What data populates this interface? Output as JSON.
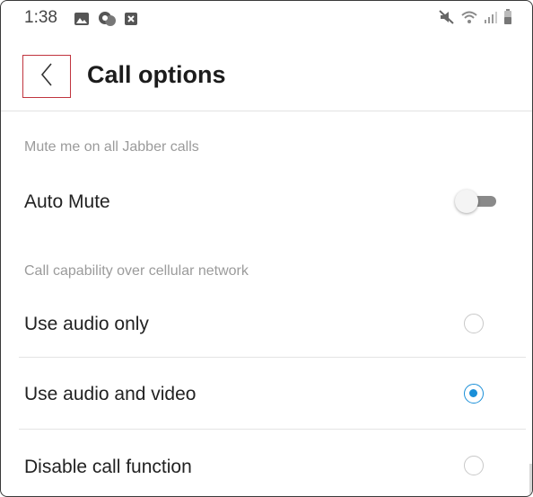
{
  "status_bar": {
    "time": "1:38",
    "left_icons": [
      "gallery-icon",
      "jabber-notification-icon",
      "close-box-icon"
    ],
    "right_icons": [
      "mute-icon",
      "wifi-icon",
      "signal-icon",
      "battery-icon"
    ]
  },
  "header": {
    "back_icon": "chevron-left-icon",
    "title": "Call options"
  },
  "sections": {
    "mute": {
      "label": "Mute me on all Jabber calls",
      "auto_mute": {
        "label": "Auto Mute",
        "enabled": false
      }
    },
    "capability": {
      "label": "Call capability over cellular network",
      "options": [
        {
          "label": "Use audio only",
          "selected": false
        },
        {
          "label": "Use audio and video",
          "selected": true
        },
        {
          "label": "Disable call function",
          "selected": false
        }
      ]
    }
  },
  "colors": {
    "accent": "#1a8fd8",
    "back_highlight": "#c0343e",
    "section_label": "#9b9b9b"
  }
}
